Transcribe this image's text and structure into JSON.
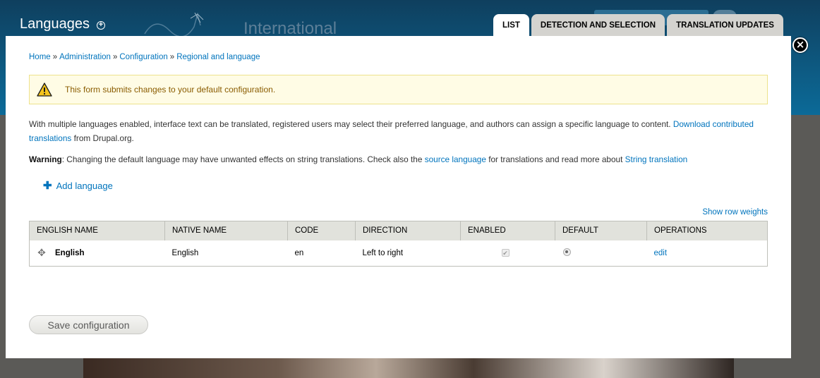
{
  "background": {
    "site_name": "International"
  },
  "overlay": {
    "title": "Languages",
    "tabs": [
      {
        "label": "LIST",
        "active": true
      },
      {
        "label": "DETECTION AND SELECTION",
        "active": false
      },
      {
        "label": "TRANSLATION UPDATES",
        "active": false
      }
    ],
    "close_glyph": "×"
  },
  "breadcrumb": {
    "items": [
      "Home",
      "Administration",
      "Configuration",
      "Regional and language"
    ],
    "separator": "»"
  },
  "warning_message": "This form submits changes to your default configuration.",
  "description": {
    "text": "With multiple languages enabled, interface text can be translated, registered users may select their preferred language, and authors can assign a specific language to content.",
    "link": "Download contributed translations",
    "suffix": "from Drupal.org."
  },
  "warning_note": {
    "label": "Warning",
    "text_1": ": Changing the default language may have unwanted effects on string translations. Check also the",
    "link_1": "source language",
    "text_2": "for translations and read more about",
    "link_2": "String translation"
  },
  "add_language_label": "Add language",
  "show_row_weights_label": "Show row weights",
  "table": {
    "columns": [
      "English name",
      "Native name",
      "Code",
      "Direction",
      "Enabled",
      "Default",
      "Operations"
    ],
    "rows": [
      {
        "english_name": "English",
        "native_name": "English",
        "code": "en",
        "direction": "Left to right",
        "enabled": true,
        "default": true,
        "operation": "edit"
      }
    ]
  },
  "save_button_label": "Save configuration",
  "colors": {
    "link": "#0074bd",
    "header_bg": "#0d5a82",
    "warning_bg": "#fffce5",
    "warning_text": "#8a5c00",
    "table_header_bg": "#e1e2dc"
  }
}
